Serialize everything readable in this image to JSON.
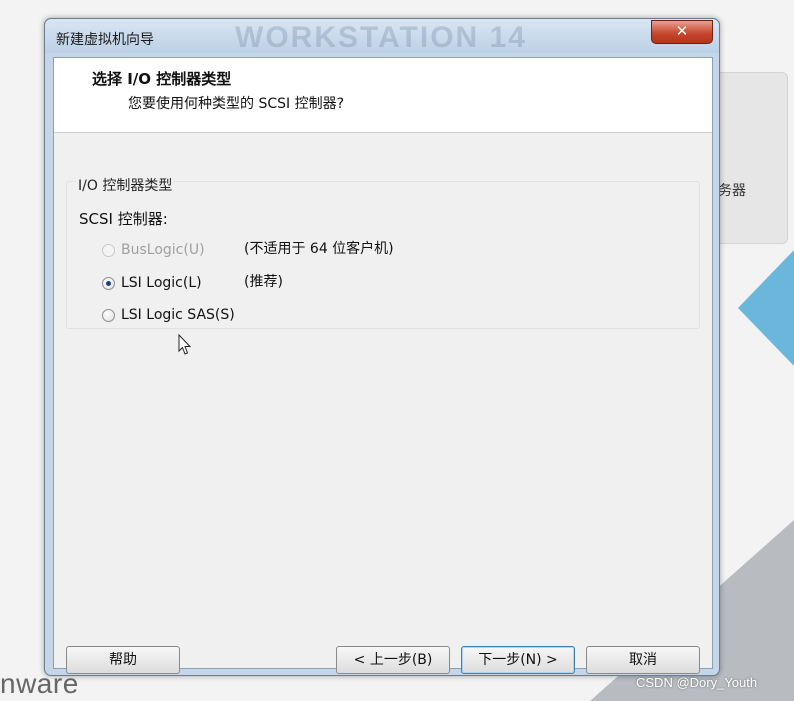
{
  "background": {
    "panel_text": "务器",
    "logo_text": "nware",
    "watermark": "CSDN @Dory_Youth",
    "colors": {
      "triangle_blue": "#6bb7dc",
      "triangle_grey": "#b8bcc0"
    }
  },
  "window": {
    "title": "新建虚拟机向导",
    "title_watermark": "WORKSTATION 14",
    "close_label": "✕"
  },
  "header": {
    "title": "选择 I/O 控制器类型",
    "subtitle": "您要使用何种类型的 SCSI 控制器?"
  },
  "group": {
    "label": "I/O 控制器类型",
    "scsi_label": "SCSI 控制器:",
    "options": [
      {
        "label": "BusLogic(U)",
        "note": "(不适用于 64 位客户机)",
        "selected": false,
        "disabled": true
      },
      {
        "label": "LSI Logic(L)",
        "note": "(推荐)",
        "selected": true,
        "disabled": false
      },
      {
        "label": "LSI Logic SAS(S)",
        "note": "",
        "selected": false,
        "disabled": false
      }
    ]
  },
  "footer": {
    "help": "帮助",
    "back": "< 上一步(B)",
    "next": "下一步(N) >",
    "cancel": "取消"
  },
  "icons": {
    "cursor": "pointer-cursor-icon",
    "close": "close-icon"
  }
}
